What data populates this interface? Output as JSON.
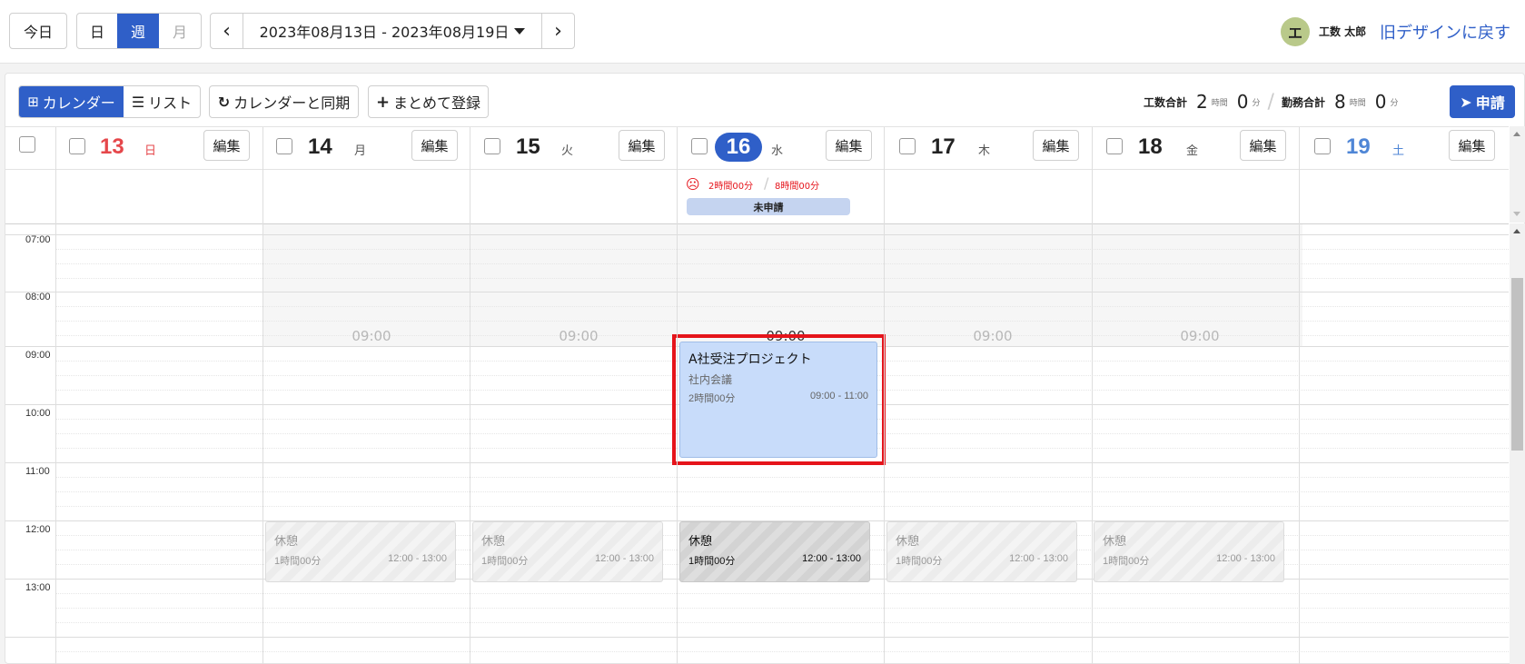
{
  "toolbar": {
    "today": "今日",
    "view_day": "日",
    "view_week": "週",
    "view_month": "月",
    "prev": "‹",
    "next": "›",
    "date_range": "2023年08月13日 - 2023年08月19日",
    "user_initial": "エ",
    "user_name": "工数 太郎",
    "old_design_link": "旧デザインに戻す"
  },
  "subbar": {
    "calendar_tab": "カレンダー",
    "list_tab": "リスト",
    "sync_button": "カレンダーと同期",
    "bulk_button": "まとめて登録",
    "kosu_label": "工数合計",
    "kosu_hours": "2",
    "kosu_hours_unit": "時間",
    "kosu_min": "0",
    "kosu_min_unit": "分",
    "kinmu_label": "勤務合計",
    "kinmu_hours": "8",
    "kinmu_hours_unit": "時間",
    "kinmu_min": "0",
    "kinmu_min_unit": "分",
    "apply_button": "申請"
  },
  "days": [
    {
      "num": "13",
      "weekday": "日",
      "edit": "編集"
    },
    {
      "num": "14",
      "weekday": "月",
      "edit": "編集"
    },
    {
      "num": "15",
      "weekday": "火",
      "edit": "編集"
    },
    {
      "num": "16",
      "weekday": "水",
      "edit": "編集"
    },
    {
      "num": "17",
      "weekday": "木",
      "edit": "編集"
    },
    {
      "num": "18",
      "weekday": "金",
      "edit": "編集"
    },
    {
      "num": "19",
      "weekday": "土",
      "edit": "編集"
    }
  ],
  "summary_wed": {
    "kosu": "2時間00分",
    "kinmu": "8時間00分",
    "status": "未申請"
  },
  "times": [
    "07:00",
    "08:00",
    "09:00",
    "10:00",
    "11:00",
    "12:00",
    "13:00"
  ],
  "start_marker": "09:00",
  "event": {
    "title": "A社受注プロジェクト",
    "subtitle": "社内会議",
    "duration": "2時間00分",
    "range": "09:00 - 11:00"
  },
  "break": {
    "title": "休憩",
    "duration": "1時間00分",
    "range": "12:00 - 13:00"
  },
  "colors": {
    "accent": "#2f5fc8",
    "sunday": "#e5474b",
    "saturday": "#4f86d6",
    "highlight": "#e5141b",
    "event_bg": "#c8dcfa"
  }
}
